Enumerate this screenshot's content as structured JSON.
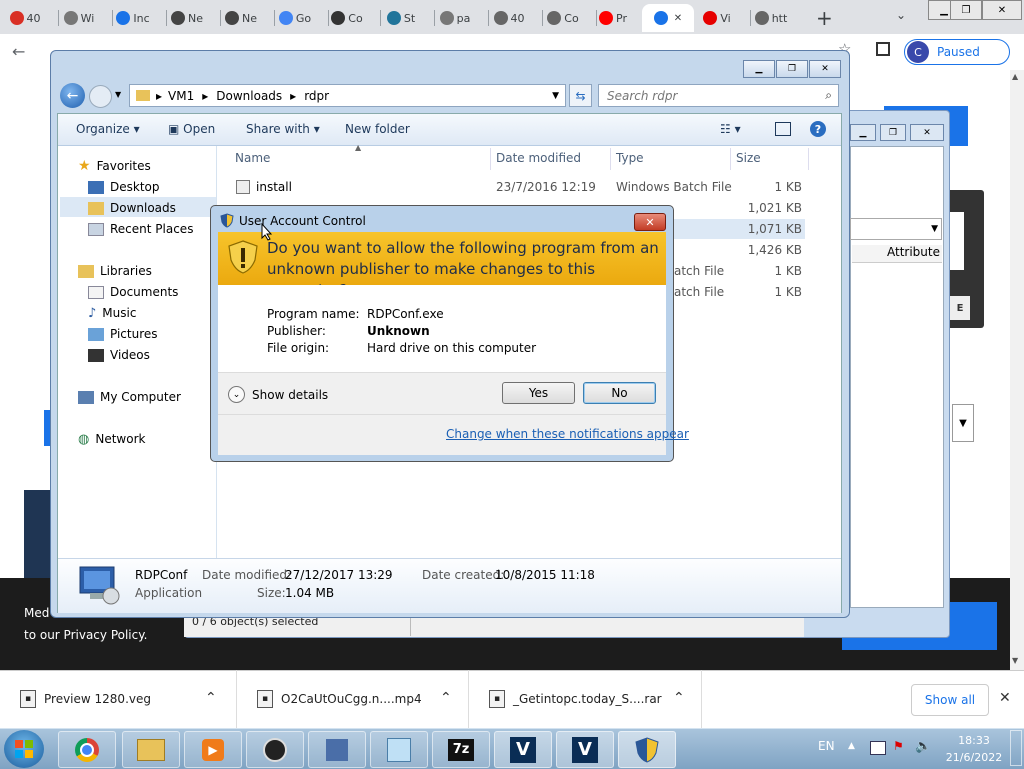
{
  "browser": {
    "tabs": [
      {
        "label": "40",
        "color": "#d93025"
      },
      {
        "label": "Wi",
        "color": "#777777"
      },
      {
        "label": "Inc",
        "color": "#1a73e8"
      },
      {
        "label": "Ne",
        "color": "#444444"
      },
      {
        "label": "Ne",
        "color": "#444444"
      },
      {
        "label": "Go",
        "color": "#4285f4"
      },
      {
        "label": "Co",
        "color": "#333333"
      },
      {
        "label": "St",
        "color": "#21759b"
      },
      {
        "label": "pa",
        "color": "#777777"
      },
      {
        "label": "40",
        "color": "#666666"
      },
      {
        "label": "Co",
        "color": "#666666"
      },
      {
        "label": "Pr",
        "color": "#ff0000"
      },
      {
        "label": "",
        "color": "#1a73e8"
      },
      {
        "label": "Vi",
        "color": "#e60000"
      },
      {
        "label": "htt",
        "color": "#666666"
      }
    ],
    "tab_close": "✕",
    "new_tab": "+",
    "profile_initial": "C",
    "profile_status": "Paused"
  },
  "page": {
    "cookie_text_1": "Med",
    "cookie_text_2": "to our Privacy Policy."
  },
  "downloads": {
    "items": [
      {
        "name": "Preview 1280.veg",
        "icon": "veg"
      },
      {
        "name": "O2CaUtOuCgg.n....mp4",
        "icon": "mp4"
      },
      {
        "name": "_Getintopc.today_S....rar",
        "icon": "rar"
      }
    ],
    "show_all": "Show all",
    "close": "✕"
  },
  "explorer": {
    "breadcrumb": [
      "VM1",
      "Downloads",
      "rdpr"
    ],
    "search_placeholder": "Search rdpr",
    "commands": {
      "organize": "Organize",
      "open": "Open",
      "share_with": "Share with",
      "new_folder": "New folder"
    },
    "nav": {
      "favorites": "Favorites",
      "desktop": "Desktop",
      "downloads": "Downloads",
      "recent_places": "Recent Places",
      "libraries": "Libraries",
      "documents": "Documents",
      "music": "Music",
      "pictures": "Pictures",
      "videos": "Videos",
      "my_computer": "My Computer",
      "network": "Network"
    },
    "columns": {
      "name": "Name",
      "date_modified": "Date modified",
      "type": "Type",
      "size": "Size"
    },
    "files": [
      {
        "name": "install",
        "date": "23/7/2016 12:19",
        "type": "Windows Batch File",
        "size": "1 KB"
      },
      {
        "name": "",
        "date": "",
        "type": "",
        "size": "1,021 KB"
      },
      {
        "name": "",
        "date": "",
        "type": "",
        "size": "1,071 KB"
      },
      {
        "name": "",
        "date": "",
        "type": "",
        "size": "1,426 KB"
      },
      {
        "name": "",
        "date": "",
        "type": "atch File",
        "size": "1 KB"
      },
      {
        "name": "",
        "date": "",
        "type": "atch File",
        "size": "1 KB"
      }
    ],
    "details": {
      "name": "RDPConf",
      "kind": "Application",
      "date_modified_label": "Date modified:",
      "date_modified": "27/12/2017 13:29",
      "date_created_label": "Date created:",
      "date_created": "10/8/2015 11:18",
      "size_label": "Size:",
      "size": "1.04 MB"
    }
  },
  "back_window": {
    "attributes_header": "Attribute",
    "status": "0 / 6 object(s) selected"
  },
  "uac": {
    "title": "User Account Control",
    "question": "Do you want to allow the following program from an unknown publisher to make changes to this computer?",
    "fields": [
      {
        "label": "Program name:",
        "value": "RDPConf.exe",
        "bold": false
      },
      {
        "label": "Publisher:",
        "value": "Unknown",
        "bold": true
      },
      {
        "label": "File origin:",
        "value": "Hard drive on this computer",
        "bold": false
      }
    ],
    "show_details": "Show details",
    "yes": "Yes",
    "no": "No",
    "change_link": "Change when these notifications appear"
  },
  "taskbar": {
    "language": "EN",
    "time": "18:33",
    "date": "21/6/2022",
    "apps": [
      "chrome",
      "explorer",
      "media-player",
      "obs",
      "editor",
      "notepad",
      "7zip",
      "vegas",
      "vegas",
      "uac-shield"
    ]
  }
}
